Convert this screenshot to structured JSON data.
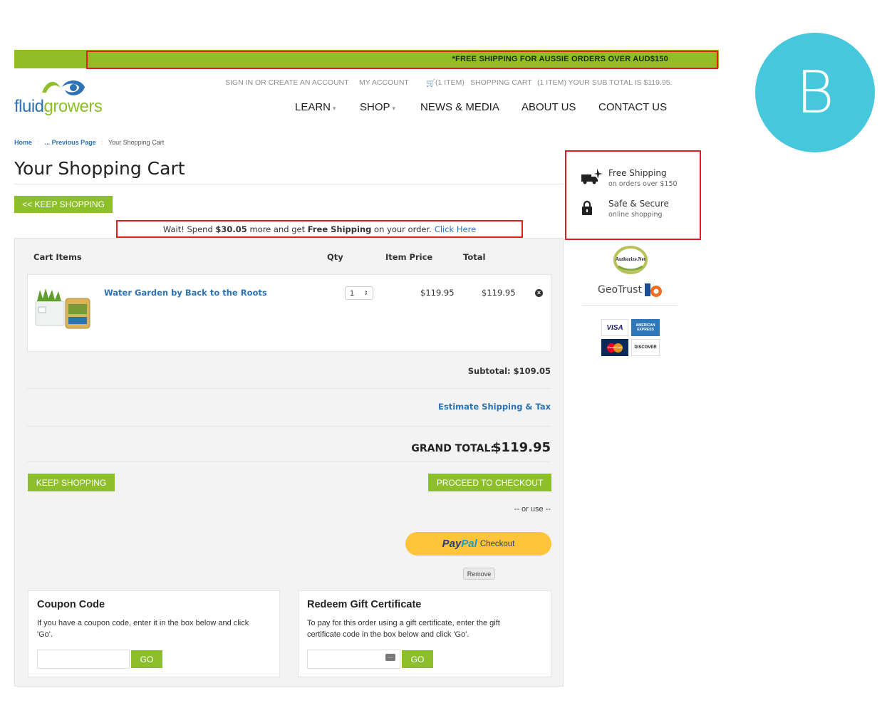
{
  "banner": {
    "text": "*FREE SHIPPING FOR AUSSIE ORDERS OVER AUD$150"
  },
  "utility": {
    "sign_in": "SIGN IN OR CREATE AN ACCOUNT",
    "my_account": "MY ACCOUNT",
    "cart_count": "(1 ITEM)",
    "shopping_cart": "SHOPPING CART",
    "subtotal": "(1 ITEM) YOUR SUB TOTAL IS $119.95."
  },
  "logo": {
    "part1": "fluid",
    "part2": "growers"
  },
  "nav": [
    "LEARN",
    "SHOP",
    "NEWS & MEDIA",
    "ABOUT US",
    "CONTACT US"
  ],
  "breadcrumb": {
    "home": "Home",
    "previous": "... Previous Page",
    "current": "Your Shopping Cart"
  },
  "page_title": "Your Shopping Cart",
  "keep_shopping_top": "<< KEEP SHOPPING",
  "free_ship_notice": {
    "pre": "Wait! Spend",
    "amount": "$30.05",
    "mid": "more and get",
    "free": "Free Shipping",
    "post": "on your order.",
    "link": "Click Here"
  },
  "cart": {
    "headers": {
      "items": "Cart Items",
      "qty": "Qty",
      "price": "Item Price",
      "total": "Total"
    },
    "item": {
      "name": "Water Garden by Back to the Roots",
      "qty": "1",
      "price": "$119.95",
      "total": "$119.95"
    },
    "subtotal": "Subtotal: $109.05",
    "estimate": "Estimate Shipping & Tax",
    "grand_total_label": "GRAND TOTAL:",
    "grand_total_value": "$119.95",
    "keep_shopping": "KEEP SHOPPING",
    "checkout": "PROCEED TO CHECKOUT",
    "or_use": "-- or use --",
    "paypal": {
      "pay": "Pay",
      "pal": "Pal",
      "checkout": "Checkout"
    },
    "remove": "Remove"
  },
  "coupon": {
    "title": "Coupon Code",
    "text": "If you have a coupon code, enter it in the box below and click 'Go'.",
    "go": "GO"
  },
  "gift": {
    "title": "Redeem Gift Certificate",
    "text": "To pay for this order using a gift certificate, enter the gift certificate code in the box below and click 'Go'.",
    "go": "GO"
  },
  "sidebar": {
    "shipping_title": "Free Shipping",
    "shipping_sub": "on orders over $150",
    "secure_title": "Safe & Secure",
    "secure_sub": "online shopping",
    "authorize": "Authorize.Net",
    "geotrust": "GeoTrust",
    "cards": [
      "VISA",
      "AMERICAN EXPRESS",
      "MasterCard",
      "DISCOVER"
    ]
  },
  "badge": "B",
  "colors": {
    "green": "#8cbf2a",
    "blue": "#2c73b5",
    "red_outline": "#e02020",
    "badge": "#47c7dc",
    "paypal": "#ffc439"
  }
}
